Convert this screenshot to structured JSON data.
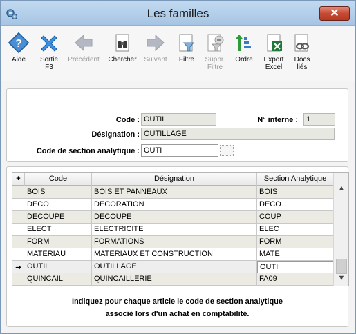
{
  "window": {
    "title": "Les familles",
    "close_label": "✕"
  },
  "toolbar": {
    "items": [
      {
        "id": "aide",
        "label": "Aide",
        "icon": "help-icon",
        "enabled": true
      },
      {
        "id": "sortie",
        "label": "Sortie\nF3",
        "icon": "close-x-icon",
        "enabled": true
      },
      {
        "id": "precedent",
        "label": "Précédent",
        "icon": "arrow-left-icon",
        "enabled": false
      },
      {
        "id": "chercher",
        "label": "Chercher",
        "icon": "binoculars-icon",
        "enabled": true
      },
      {
        "id": "suivant",
        "label": "Suivant",
        "icon": "arrow-right-icon",
        "enabled": false
      },
      {
        "id": "filtre",
        "label": "Filtre",
        "icon": "filter-icon",
        "enabled": true
      },
      {
        "id": "suppr_filtre",
        "label": "Suppr.\nFiltre",
        "icon": "remove-filter-icon",
        "enabled": false
      },
      {
        "id": "ordre",
        "label": "Ordre",
        "icon": "sort-order-icon",
        "enabled": true
      },
      {
        "id": "export_excel",
        "label": "Export\nExcel",
        "icon": "excel-icon",
        "enabled": true
      },
      {
        "id": "docs_lies",
        "label": "Docs\nliés",
        "icon": "link-docs-icon",
        "enabled": true
      }
    ]
  },
  "form": {
    "code_label": "Code :",
    "code_value": "OUTIL",
    "num_interne_label": "N° interne :",
    "num_interne_value": "1",
    "designation_label": "Désignation :",
    "designation_value": "OUTILLAGE",
    "section_label": "Code de section analytique :",
    "section_value": "OUTI"
  },
  "grid": {
    "add_glyph": "+",
    "columns": [
      "Code",
      "Désignation",
      "Section Analytique"
    ],
    "rows": [
      {
        "code": "BOIS",
        "designation": "BOIS ET PANNEAUX",
        "section": "BOIS"
      },
      {
        "code": "DECO",
        "designation": "DECORATION",
        "section": "DECO"
      },
      {
        "code": "DECOUPE",
        "designation": "DECOUPE",
        "section": "COUP"
      },
      {
        "code": "ELECT",
        "designation": "ELECTRICITE",
        "section": "ELEC"
      },
      {
        "code": "FORM",
        "designation": "FORMATIONS",
        "section": "FORM"
      },
      {
        "code": "MATERIAU",
        "designation": "MATERIAUX ET CONSTRUCTION",
        "section": "MATE"
      },
      {
        "code": "OUTIL",
        "designation": "OUTILLAGE",
        "section": "OUTI",
        "current": true
      },
      {
        "code": "QUINCAIL",
        "designation": "QUINCAILLERIE",
        "section": "FA09"
      }
    ],
    "current_marker": "➜"
  },
  "info": {
    "line1": "Indiquez pour chaque article le code de section analytique",
    "line2": "associé lors d'un achat en comptabilité."
  },
  "colors": {
    "titlebar": "#b4cfea",
    "close": "#c64b35",
    "row_alt": "#ebebe4"
  }
}
